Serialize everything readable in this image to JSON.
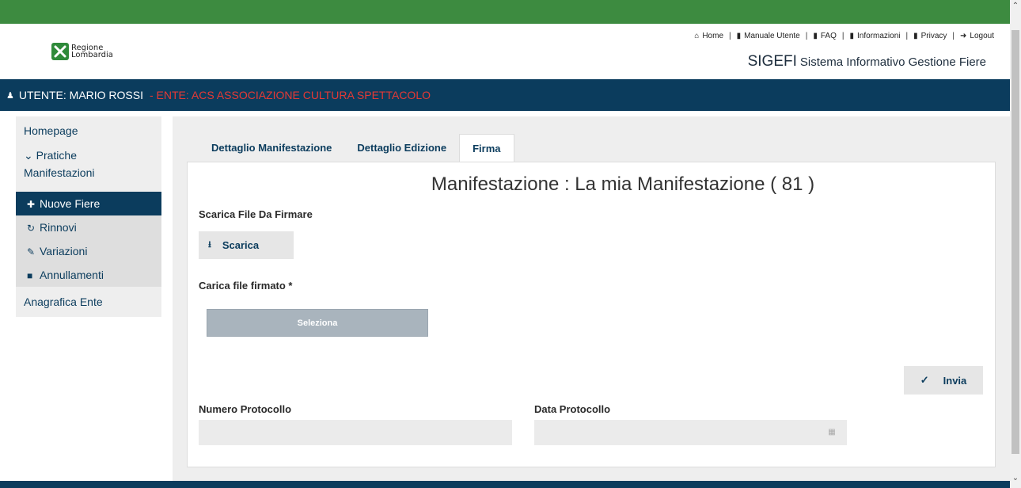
{
  "header": {
    "logo_text_line1": "Regione",
    "logo_text_line2": "Lombardia",
    "links": [
      {
        "icon": "home-icon",
        "label": "Home"
      },
      {
        "icon": "file-icon",
        "label": "Manuale Utente"
      },
      {
        "icon": "book-icon",
        "label": "FAQ"
      },
      {
        "icon": "file-icon",
        "label": "Informazioni"
      },
      {
        "icon": "file-icon",
        "label": "Privacy"
      },
      {
        "icon": "logout-icon",
        "label": "Logout"
      }
    ],
    "app_acronym": "SIGEFI",
    "app_name": "Sistema Informativo Gestione Fiere"
  },
  "userbar": {
    "user": "UTENTE: MARIO ROSSI",
    "ente": "- ENTE: ACS ASSOCIAZIONE CULTURA SPETTACOLO"
  },
  "sidebar": {
    "home": "Homepage",
    "pratiche_line1": "Pratiche",
    "pratiche_line2": "Manifestazioni",
    "subitems": [
      {
        "icon": "plus-icon",
        "label": "Nuove Fiere",
        "active": true
      },
      {
        "icon": "refresh-icon",
        "label": "Rinnovi",
        "active": false
      },
      {
        "icon": "pencil-icon",
        "label": "Variazioni",
        "active": false
      },
      {
        "icon": "trash-icon",
        "label": "Annullamenti",
        "active": false
      }
    ],
    "anagrafica": "Anagrafica Ente"
  },
  "tabs": [
    "Dettaglio Manifestazione",
    "Dettaglio Edizione",
    "Firma"
  ],
  "panel": {
    "title": "Manifestazione : La mia Manifestazione ( 81 )",
    "scarica_label": "Scarica File Da Firmare",
    "scarica_button": "Scarica",
    "carica_label": "Carica file firmato *",
    "seleziona_button": "Seleziona",
    "invia_button": "Invia",
    "numero_protocollo_label": "Numero Protocollo",
    "numero_protocollo_value": "",
    "data_protocollo_label": "Data Protocollo",
    "data_protocollo_value": ""
  },
  "colors": {
    "topbar": "#3d8b40",
    "navy": "#0b3c5d",
    "ente_red": "#e53935"
  }
}
